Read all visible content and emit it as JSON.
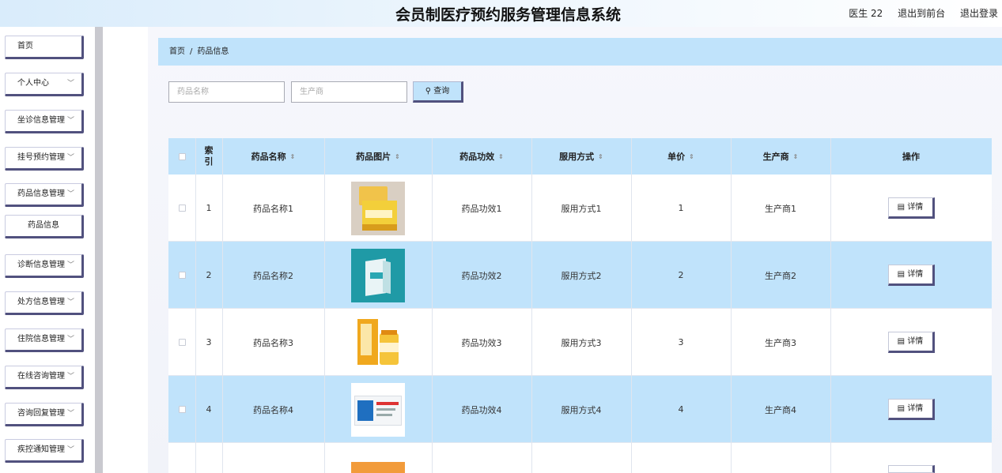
{
  "header": {
    "title": "会员制医疗预约服务管理信息系统",
    "user": "医生 22",
    "to_front": "退出到前台",
    "logout": "退出登录"
  },
  "sidebar": {
    "items": [
      {
        "label": "首页",
        "has_chevron": false
      },
      {
        "label": "个人中心",
        "has_chevron": true
      },
      {
        "label": "坐诊信息管理",
        "has_chevron": true
      },
      {
        "label": "挂号预约管理",
        "has_chevron": true
      },
      {
        "label": "药品信息管理",
        "has_chevron": true
      },
      {
        "label": "药品信息",
        "has_chevron": false,
        "sub": true
      },
      {
        "label": "诊断信息管理",
        "has_chevron": true
      },
      {
        "label": "处方信息管理",
        "has_chevron": true
      },
      {
        "label": "住院信息管理",
        "has_chevron": true
      },
      {
        "label": "在线咨询管理",
        "has_chevron": true
      },
      {
        "label": "咨询回复管理",
        "has_chevron": true
      },
      {
        "label": "疾控通知管理",
        "has_chevron": true
      }
    ]
  },
  "breadcrumb": {
    "home": "首页",
    "sep": "/",
    "current": "药品信息"
  },
  "search": {
    "name_placeholder": "药品名称",
    "maker_placeholder": "生产商",
    "button": "查询"
  },
  "table": {
    "headers": {
      "index": "索引",
      "name": "药品名称",
      "image": "药品图片",
      "effect": "药品功效",
      "usage": "服用方式",
      "price": "单价",
      "maker": "生产商",
      "action": "操作"
    },
    "rows": [
      {
        "index": "1",
        "name": "药品名称1",
        "effect": "药品功效1",
        "usage": "服用方式1",
        "price": "1",
        "maker": "生产商1"
      },
      {
        "index": "2",
        "name": "药品名称2",
        "effect": "药品功效2",
        "usage": "服用方式2",
        "price": "2",
        "maker": "生产商2"
      },
      {
        "index": "3",
        "name": "药品名称3",
        "effect": "药品功效3",
        "usage": "服用方式3",
        "price": "3",
        "maker": "生产商3"
      },
      {
        "index": "4",
        "name": "药品名称4",
        "effect": "药品功效4",
        "usage": "服用方式4",
        "price": "4",
        "maker": "生产商4"
      }
    ],
    "detail_label": "详情"
  },
  "colors": {
    "accent": "#c0e3fb",
    "border_dark": "#51517e"
  }
}
